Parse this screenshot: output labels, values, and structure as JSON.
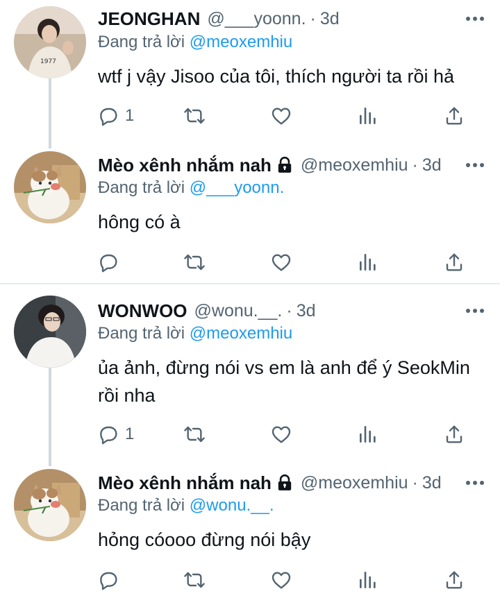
{
  "colors": {
    "accent": "#1d9bf0",
    "muted": "#536471",
    "text": "#0f1419",
    "line": "#cfd9de"
  },
  "tweets": [
    {
      "name": "JEONGHAN",
      "handle": "@___yoonn.",
      "dot": "·",
      "time": "3d",
      "reply_label": "Đang trả lời",
      "reply_mention": "@meoxemhiu",
      "text": "wtf j vậy Jisoo của tôi, thích người ta rồi hả",
      "reply_count": "1",
      "avatar_icon": "person-avatar",
      "locked": false
    },
    {
      "name": "Mèo xênh nhắm nah",
      "handle": "@meoxemhiu",
      "dot": "·",
      "time": "3d",
      "reply_label": "Đang trả lời",
      "reply_mention": "@___yoonn.",
      "text": "hông có à",
      "reply_count": "",
      "avatar_icon": "cat-avatar",
      "locked": true
    },
    {
      "name": "WONWOO",
      "handle": "@wonu.__.",
      "dot": "·",
      "time": "3d",
      "reply_label": "Đang trả lời",
      "reply_mention": "@meoxemhiu",
      "text": "ủa ảnh, đừng nói vs em là anh để ý SeokMin rồi nha",
      "reply_count": "1",
      "avatar_icon": "person-avatar",
      "locked": false
    },
    {
      "name": "Mèo xênh nhắm nah",
      "handle": "@meoxemhiu",
      "dot": "·",
      "time": "3d",
      "reply_label": "Đang trả lời",
      "reply_mention": "@wonu.__.",
      "text": "hỏng cóooo đừng nói bậy",
      "reply_count": "",
      "avatar_icon": "cat-avatar",
      "locked": true
    }
  ]
}
